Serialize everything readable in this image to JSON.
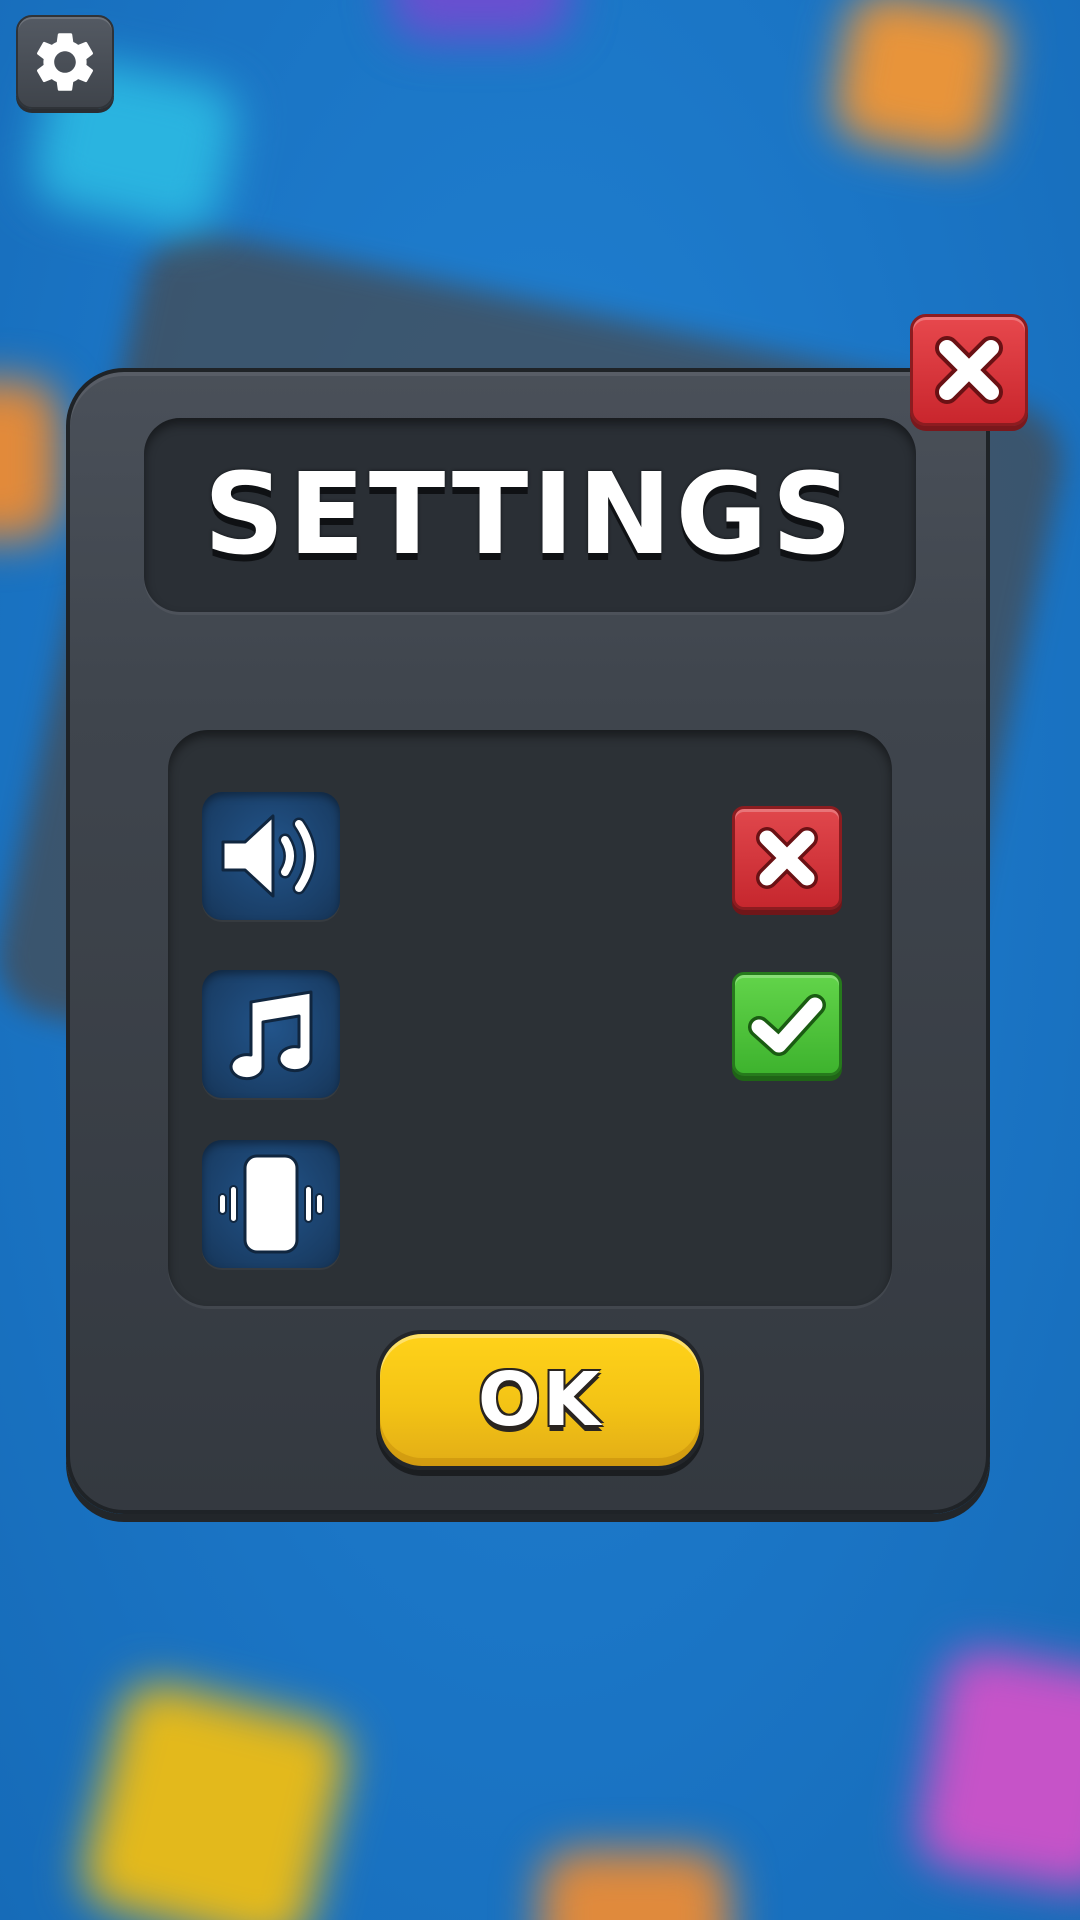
{
  "settings_button": {
    "icon": "gear-icon"
  },
  "dialog": {
    "title": "SETTINGS",
    "close_icon": "close-icon",
    "options": [
      {
        "id": "sound",
        "icon": "speaker-icon",
        "state": "off",
        "toggle_icon": "cross-icon"
      },
      {
        "id": "music",
        "icon": "music-note-icon",
        "state": "on",
        "toggle_icon": "checkmark-icon"
      },
      {
        "id": "vibration",
        "icon": "phone-vibrate-icon"
      }
    ],
    "ok_label": "OK"
  },
  "colors": {
    "background": "#1c78c8",
    "panel": "#3f454d",
    "toggle_off": "#d3353b",
    "toggle_on": "#4cc23a",
    "ok_button": "#f3c315",
    "icon_tile": "#1e4a7a"
  }
}
